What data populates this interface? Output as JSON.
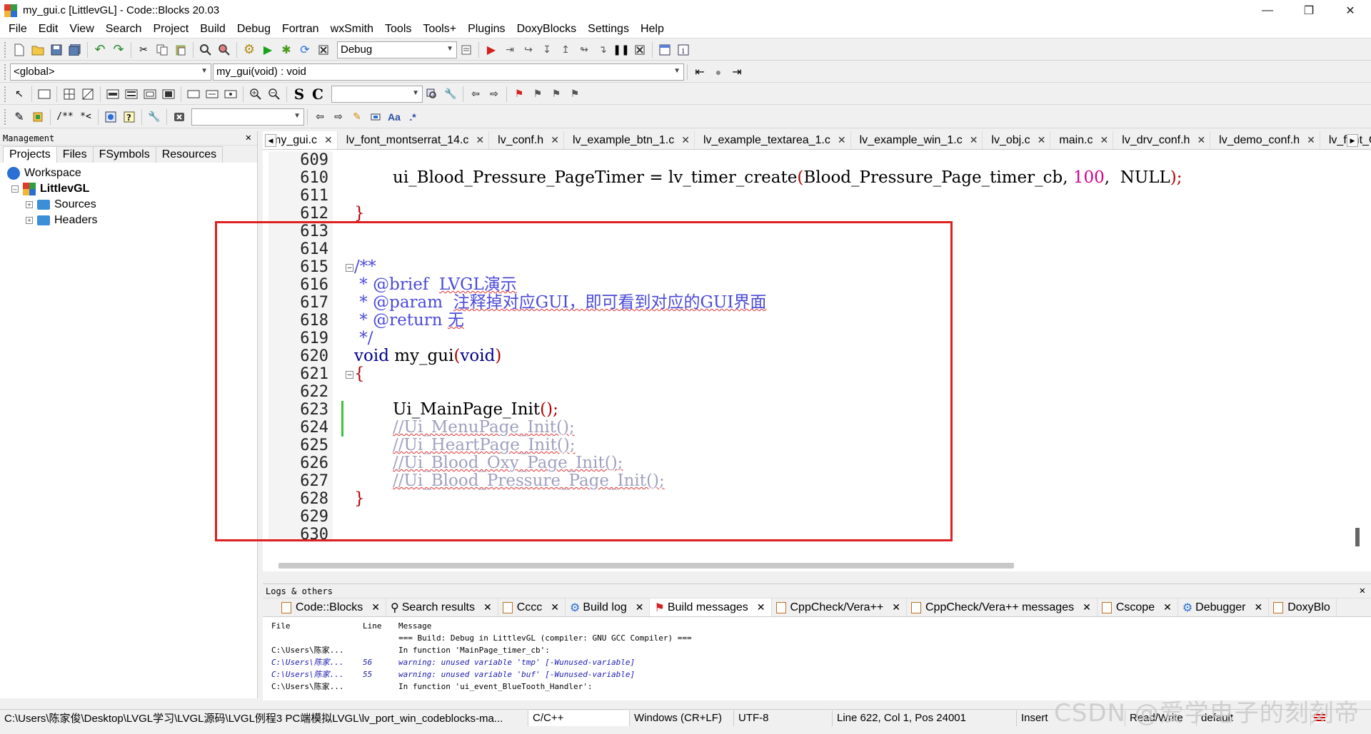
{
  "window": {
    "title": "my_gui.c [LittlevGL] - Code::Blocks 20.03"
  },
  "menu": [
    "File",
    "Edit",
    "View",
    "Search",
    "Project",
    "Build",
    "Debug",
    "Fortran",
    "wxSmith",
    "Tools",
    "Tools+",
    "Plugins",
    "DoxyBlocks",
    "Settings",
    "Help"
  ],
  "toolbar": {
    "build_target": "Debug",
    "scope": "<global>",
    "function": "my_gui(void) : void"
  },
  "management": {
    "title": "Management",
    "tabs": [
      "Projects",
      "Files",
      "FSymbols",
      "Resources"
    ],
    "tree": {
      "workspace": "Workspace",
      "project": "LittlevGL",
      "sources": "Sources",
      "headers": "Headers"
    }
  },
  "editor_tabs": [
    "my_gui.c",
    "lv_font_montserrat_14.c",
    "lv_conf.h",
    "lv_example_btn_1.c",
    "lv_example_textarea_1.c",
    "lv_example_win_1.c",
    "lv_obj.c",
    "main.c",
    "lv_drv_conf.h",
    "lv_demo_conf.h",
    "lv_font_Ch"
  ],
  "line_numbers": [
    "609",
    "610",
    "611",
    "612",
    "613",
    "614",
    "615",
    "616",
    "617",
    "618",
    "619",
    "620",
    "621",
    "622",
    "623",
    "624",
    "625",
    "626",
    "627",
    "628",
    "629",
    "630"
  ],
  "code": {
    "l610_a": "ui_Blood_Pressure_PageTimer = lv_timer_create",
    "l610_b": "(",
    "l610_c": "Blood_Pressure_Page_timer_cb, ",
    "l610_d": "100",
    "l610_e": ",  NULL",
    "l610_f": ");",
    "l612": "}",
    "l615": "/**",
    "l616_tag": " * @brief  ",
    "l616_txt": "LVGL演示",
    "l617_tag": " * @param  ",
    "l617_txt": "注释掉对应GUI，即可看到对应的GUI界面",
    "l618_tag": " * @return ",
    "l618_txt": "无",
    "l619": " */",
    "l620_kw": "void",
    "l620_fn": " my_gui",
    "l620_p1": "(",
    "l620_kw2": "void",
    "l620_p2": ")",
    "l621": "{",
    "l623_a": "Ui_MainPage_Init",
    "l623_b": "();",
    "l624": "//Ui_MenuPage_Init();",
    "l625": "//Ui_HeartPage_Init();",
    "l626": "//Ui_Blood_Oxy_Page_Init();",
    "l627": "//Ui_Blood_Pressure_Page_Init();",
    "l628": "}"
  },
  "logs": {
    "title": "Logs & others",
    "tabs": [
      "Code::Blocks",
      "Search results",
      "Cccc",
      "Build log",
      "Build messages",
      "CppCheck/Vera++",
      "CppCheck/Vera++ messages",
      "Cscope",
      "Debugger",
      "DoxyBlo"
    ],
    "columns": {
      "file": "File",
      "line": "Line",
      "message": "Message"
    },
    "rows": [
      {
        "file": "",
        "line": "",
        "message": "=== Build: Debug in LittlevGL (compiler: GNU GCC Compiler) ==="
      },
      {
        "file": "C:\\Users\\陈家...",
        "line": "",
        "message": "In function 'MainPage_timer_cb':"
      },
      {
        "file": "C:\\Users\\陈家...",
        "line": "56",
        "message": "warning: unused variable 'tmp' [-Wunused-variable]"
      },
      {
        "file": "C:\\Users\\陈家...",
        "line": "55",
        "message": "warning: unused variable 'buf' [-Wunused-variable]"
      },
      {
        "file": "C:\\Users\\陈家...",
        "line": "",
        "message": "In function 'ui_event_BlueTooth_Handler':"
      }
    ]
  },
  "status": {
    "path": "C:\\Users\\陈家俊\\Desktop\\LVGL学习\\LVGL源码\\LVGL例程3 PC端模拟LVGL\\lv_port_win_codeblocks-ma...",
    "lang": "C/C++",
    "eol": "Windows (CR+LF)",
    "enc": "UTF-8",
    "pos": "Line 622, Col 1, Pos 24001",
    "mode": "Insert",
    "rw": "Read/Write",
    "profile": "default"
  },
  "watermark": "CSDN @爱学电子的刻刻帝",
  "colors": {
    "highlight_box": "#e02020",
    "keyword": "#00008b",
    "number": "#d4008b",
    "doc": "#4a4ad8",
    "comment": "#a0a0c0"
  }
}
